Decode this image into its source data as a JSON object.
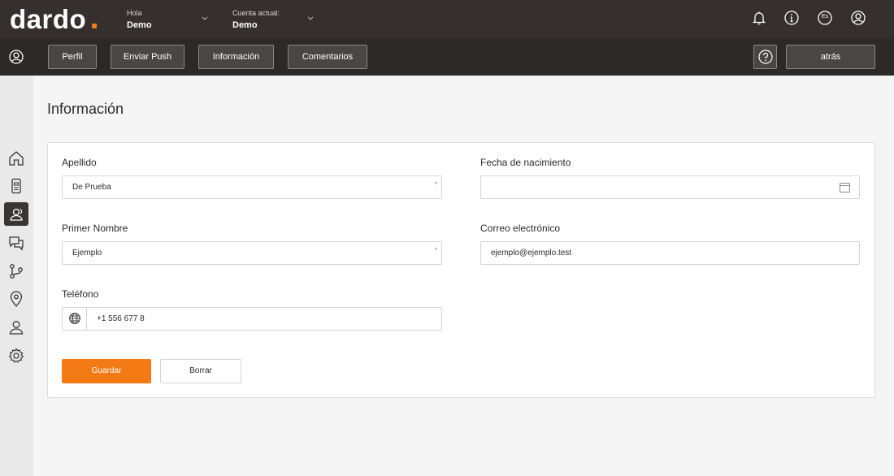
{
  "header": {
    "logo": "dardo",
    "greeting_small": "Hola",
    "greeting_name": "Demo",
    "account_small": "Cuenta actual:",
    "account_name": "Demo",
    "icons": [
      "bell-icon",
      "info-icon",
      "language-icon",
      "account-icon"
    ],
    "language_code": "Es"
  },
  "nav": {
    "buttons": [
      "Perfil",
      "Enviar Push",
      "Información",
      "Comentarios"
    ],
    "help_icon": "question-icon",
    "back_label": "atrás"
  },
  "sidebar": {
    "icons": [
      "home-icon",
      "device-icon",
      "users-icon",
      "chat-icon",
      "flow-icon",
      "location-icon",
      "user-icon",
      "settings-icon"
    ],
    "active_index": 2
  },
  "main": {
    "title": "Información",
    "fields": {
      "last_name": {
        "label": "Apellido",
        "value": "De Prueba",
        "required_mark": "*"
      },
      "birth_date": {
        "label": "Fecha de nacimiento",
        "value": ""
      },
      "first_name": {
        "label": "Primer Nombre",
        "value": "Ejemplo",
        "required_mark": "*"
      },
      "email": {
        "label": "Correo electrónico",
        "value": "ejemplo@ejemplo.test"
      },
      "phone": {
        "label": "Teléfono",
        "value": "+1 556 677 8"
      }
    },
    "save_label": "Guardar",
    "clear_label": "Borrar"
  },
  "colors": {
    "accent": "#f47a16",
    "topbar": "#35302e",
    "navbar": "#2c2927",
    "sidebar": "#e9e9e9",
    "background": "#f5f5f5"
  }
}
